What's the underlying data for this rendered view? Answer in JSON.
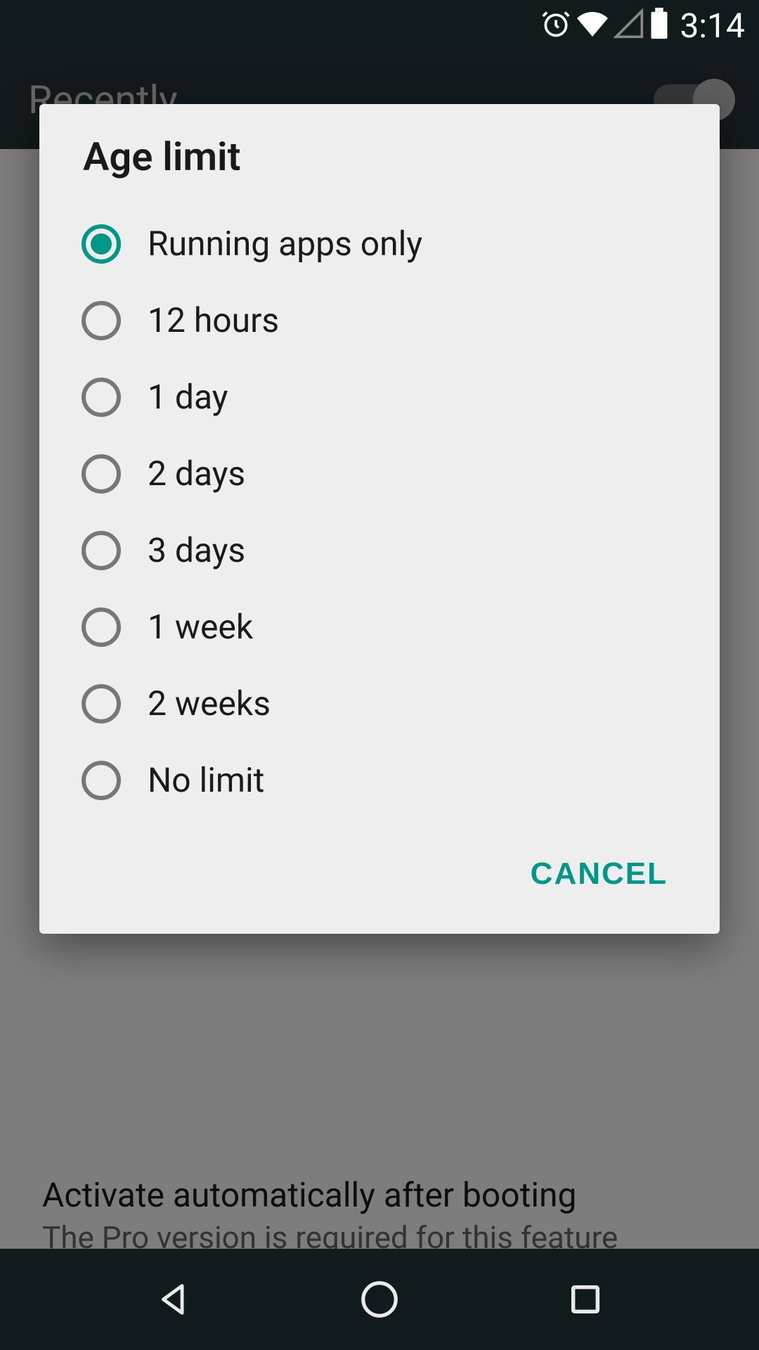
{
  "status_bar": {
    "time": "3:14"
  },
  "header": {
    "title": "Recently"
  },
  "background": {
    "booting_title": "Activate automatically after booting",
    "booting_sub": "The Pro version is required for this feature"
  },
  "dialog": {
    "title": "Age limit",
    "options": [
      {
        "label": "Running apps only",
        "selected": true
      },
      {
        "label": "12 hours",
        "selected": false
      },
      {
        "label": "1 day",
        "selected": false
      },
      {
        "label": "2 days",
        "selected": false
      },
      {
        "label": "3 days",
        "selected": false
      },
      {
        "label": "1 week",
        "selected": false
      },
      {
        "label": "2 weeks",
        "selected": false
      },
      {
        "label": "No limit",
        "selected": false
      }
    ],
    "cancel_label": "CANCEL"
  },
  "colors": {
    "accent": "#009688",
    "header_bg": "#263238",
    "dialog_bg": "#eeeeee"
  }
}
